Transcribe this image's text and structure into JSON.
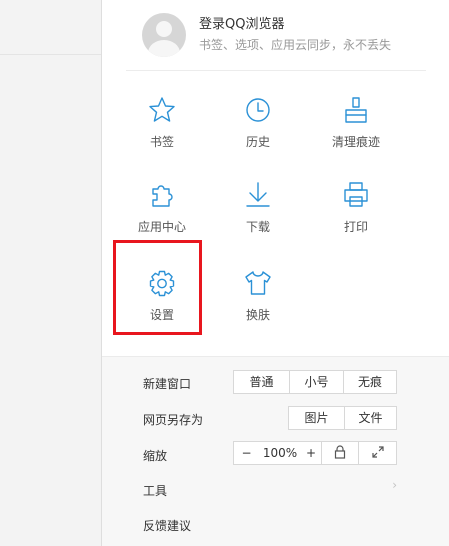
{
  "login": {
    "title": "登录QQ浏览器",
    "subtitle": "书签、选项、应用云同步，永不丢失"
  },
  "grid": {
    "bookmarks": "书签",
    "history": "历史",
    "clear_traces": "清理痕迹",
    "app_center": "应用中心",
    "download": "下载",
    "print": "打印",
    "settings": "设置",
    "skin": "换肤"
  },
  "new_window": {
    "label": "新建窗口",
    "normal": "普通",
    "small": "小号",
    "incognito": "无痕"
  },
  "save_as": {
    "label": "网页另存为",
    "image": "图片",
    "file": "文件"
  },
  "zoom": {
    "label": "缩放",
    "minus": "−",
    "value": "100%",
    "plus": "+"
  },
  "tools": {
    "label": "工具",
    "chevron": "›"
  },
  "feedback": {
    "label": "反馈建议"
  },
  "icons": {
    "bookmarks": "star-icon",
    "history": "clock-icon",
    "clear_traces": "broom-icon",
    "app_center": "puzzle-icon",
    "download": "download-icon",
    "print": "printer-icon",
    "settings": "gear-icon",
    "skin": "shirt-icon",
    "lock": "lock-icon",
    "fullscreen": "expand-icon"
  },
  "colors": {
    "accent": "#2b91d6",
    "highlight": "#e8161e"
  }
}
